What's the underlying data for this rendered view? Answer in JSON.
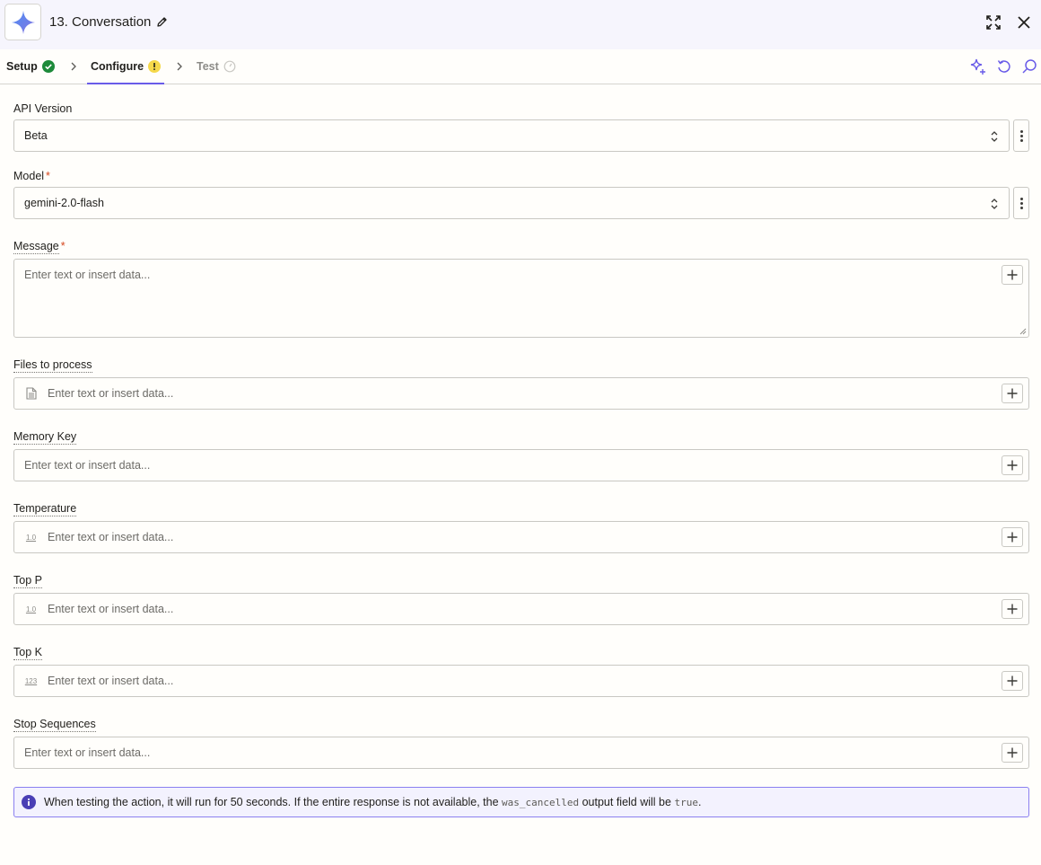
{
  "header": {
    "logo_icon": "gemini-sparkle-icon",
    "title": "13. Conversation"
  },
  "tabs": [
    {
      "label": "Setup",
      "status": "complete"
    },
    {
      "label": "Configure",
      "status": "warning"
    },
    {
      "label": "Test",
      "status": "disabled"
    }
  ],
  "fields": {
    "api_version": {
      "label": "API Version",
      "value": "Beta"
    },
    "model": {
      "label": "Model",
      "required_mark": "*",
      "value": "gemini-2.0-flash"
    },
    "message": {
      "label": "Message",
      "required_mark": "*",
      "placeholder": "Enter text or insert data..."
    },
    "files": {
      "label": "Files to process",
      "placeholder": "Enter text or insert data..."
    },
    "memory_key": {
      "label": "Memory Key",
      "placeholder": "Enter text or insert data..."
    },
    "temperature": {
      "label": "Temperature",
      "placeholder": "Enter text or insert data...",
      "type_hint": "1.0"
    },
    "top_p": {
      "label": "Top P",
      "placeholder": "Enter text or insert data...",
      "type_hint": "1.0"
    },
    "top_k": {
      "label": "Top K",
      "placeholder": "Enter text or insert data...",
      "type_hint": "123"
    },
    "stop_sequences": {
      "label": "Stop Sequences",
      "placeholder": "Enter text or insert data..."
    }
  },
  "info": {
    "text_before": "When testing the action, it will run for 50 seconds. If the entire response is not available, the",
    "code1": "was_cancelled",
    "text_middle": "output field will be",
    "code2": "true",
    "text_after": "."
  },
  "colors": {
    "accent": "#695be8",
    "success": "#1d8a3a",
    "warning": "#f5d84a",
    "required": "#d6461d",
    "header_bg": "#f6f5fd"
  }
}
